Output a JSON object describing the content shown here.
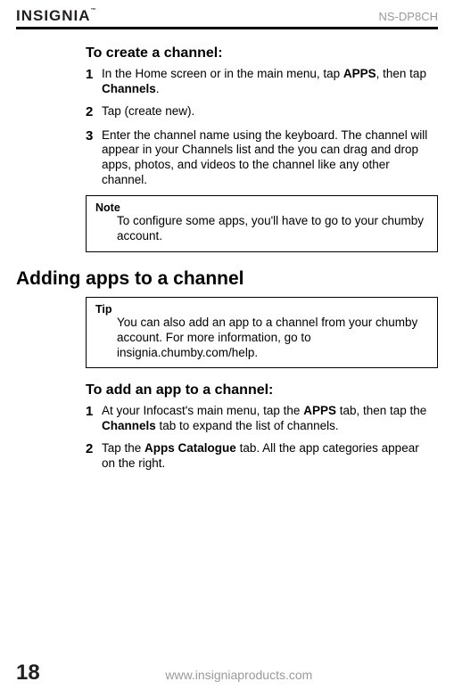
{
  "header": {
    "logo": "INSIGNIA",
    "logo_tm": "™",
    "model": "NS-DP8CH"
  },
  "section1": {
    "title": "To create a channel:",
    "steps": [
      {
        "num": "1",
        "pre": "In the Home screen or in the main menu, tap ",
        "b1": "APPS",
        "mid": ", then tap ",
        "b2": "Channels",
        "post": "."
      },
      {
        "num": "2",
        "text": "Tap (create new)."
      },
      {
        "num": "3",
        "text": "Enter the channel name using the keyboard. The channel will appear in your Channels list and the you can drag and drop apps, photos, and videos to the channel like any other channel."
      }
    ],
    "note": {
      "label": "Note",
      "body": "To configure some apps, you'll have to go to your chumby account."
    }
  },
  "h1": "Adding apps to a channel",
  "tip": {
    "label": "Tip",
    "body": "You can also add an app to a channel from your chumby account. For more information, go to insignia.chumby.com/help."
  },
  "section2": {
    "title": "To add an app to a channel:",
    "steps": [
      {
        "num": "1",
        "pre": "At your Infocast's main menu, tap the ",
        "b1": "APPS",
        "mid": " tab, then tap the ",
        "b2": "Channels",
        "post": " tab to expand the list of channels."
      },
      {
        "num": "2",
        "pre": "Tap the ",
        "b1": "Apps Catalogue",
        "post": " tab. All the app categories appear on the right."
      }
    ]
  },
  "footer": {
    "page": "18",
    "url": "www.insigniaproducts.com"
  }
}
